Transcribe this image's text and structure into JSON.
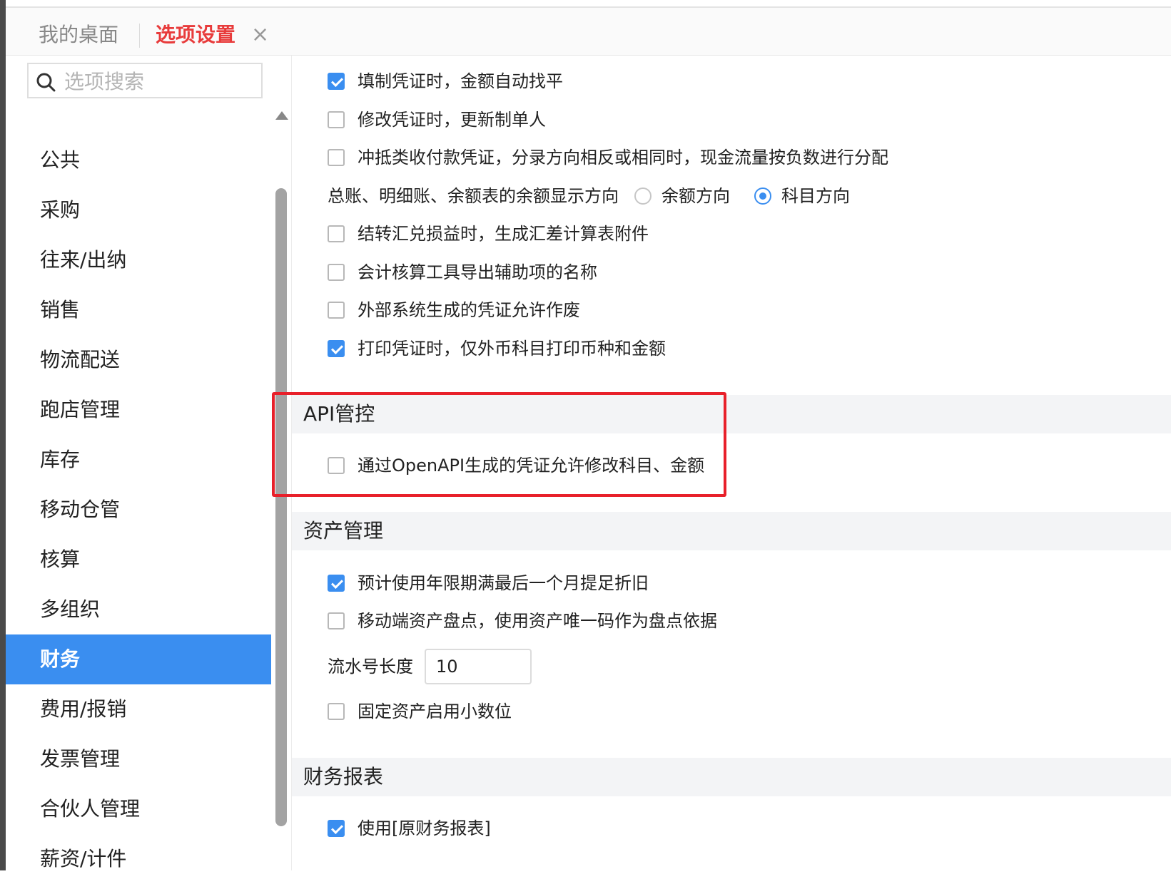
{
  "tabs": {
    "desktop_label": "我的桌面",
    "options_label": "选项设置",
    "close_glyph": "×"
  },
  "sidebar": {
    "search_placeholder": "选项搜索",
    "items": [
      "公共",
      "采购",
      "往来/出纳",
      "销售",
      "物流配送",
      "跑店管理",
      "库存",
      "移动仓管",
      "核算",
      "多组织",
      "财务",
      "费用/报销",
      "发票管理",
      "合伙人管理",
      "薪资/计件"
    ],
    "active_item": "财务"
  },
  "finance_options": {
    "opt1": {
      "label": "填制凭证时，金额自动找平",
      "checked": true
    },
    "opt2": {
      "label": "修改凭证时，更新制单人",
      "checked": false
    },
    "opt3": {
      "label": "冲抵类收付款凭证，分录方向相反或相同时，现金流量按负数进行分配",
      "checked": false
    },
    "balance_direction": {
      "label": "总账、明细账、余额表的余额显示方向",
      "option_a": "余额方向",
      "option_b": "科目方向",
      "selected": "科目方向"
    },
    "opt4": {
      "label": "结转汇兑损益时，生成汇差计算表附件",
      "checked": false
    },
    "opt5": {
      "label": "会计核算工具导出辅助项的名称",
      "checked": false
    },
    "opt6": {
      "label": "外部系统生成的凭证允许作废",
      "checked": false
    },
    "opt7": {
      "label": "打印凭证时，仅外币科目打印币种和金额",
      "checked": true
    }
  },
  "api_section": {
    "title": "API管控",
    "opt1": {
      "label": "通过OpenAPI生成的凭证允许修改科目、金额",
      "checked": false
    }
  },
  "asset_section": {
    "title": "资产管理",
    "opt1": {
      "label": "预计使用年限期满最后一个月提足折旧",
      "checked": true
    },
    "opt2": {
      "label": "移动端资产盘点，使用资产唯一码作为盘点依据",
      "checked": false
    },
    "serial_label": "流水号长度",
    "serial_value": "10",
    "opt3": {
      "label": "固定资产启用小数位",
      "checked": false
    }
  },
  "report_section": {
    "title": "财务报表",
    "opt1": {
      "label": "使用[原财务报表]",
      "checked": true
    }
  },
  "colors": {
    "accent": "#3a8ef0",
    "tab_active": "#e8383d",
    "highlight": "#e8202a"
  }
}
